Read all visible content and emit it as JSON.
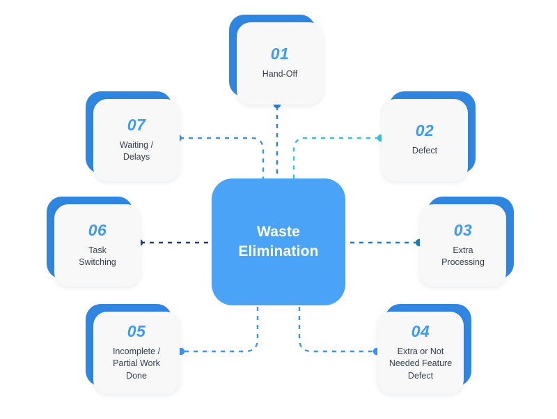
{
  "diagram": {
    "title": "Waste Elimination",
    "center": {
      "label": "Waste\nElimination",
      "color": "#4aa3f7",
      "text_color": "#ffffff"
    },
    "card_face_color": "#f8f8f9",
    "card_back_color": "#2f86e0",
    "number_color": "#3d9bf5",
    "label_color": "#35404f",
    "nodes": [
      {
        "number": "01",
        "label": "Hand-Off",
        "connector_color": "#2b7fd4"
      },
      {
        "number": "02",
        "label": "Defect",
        "connector_color": "#33c4dd"
      },
      {
        "number": "03",
        "label": "Extra\nProcessing",
        "connector_color": "#1a7ec4"
      },
      {
        "number": "04",
        "label": "Extra or Not\nNeeded Feature\nDefect",
        "connector_color": "#3d93f0"
      },
      {
        "number": "05",
        "label": "Incomplete /\nPartial Work\nDone",
        "connector_color": "#3d93f0"
      },
      {
        "number": "06",
        "label": "Task\nSwitching",
        "connector_color": "#233a77"
      },
      {
        "number": "07",
        "label": "Waiting /\nDelays",
        "connector_color": "#3d93f0"
      }
    ]
  }
}
